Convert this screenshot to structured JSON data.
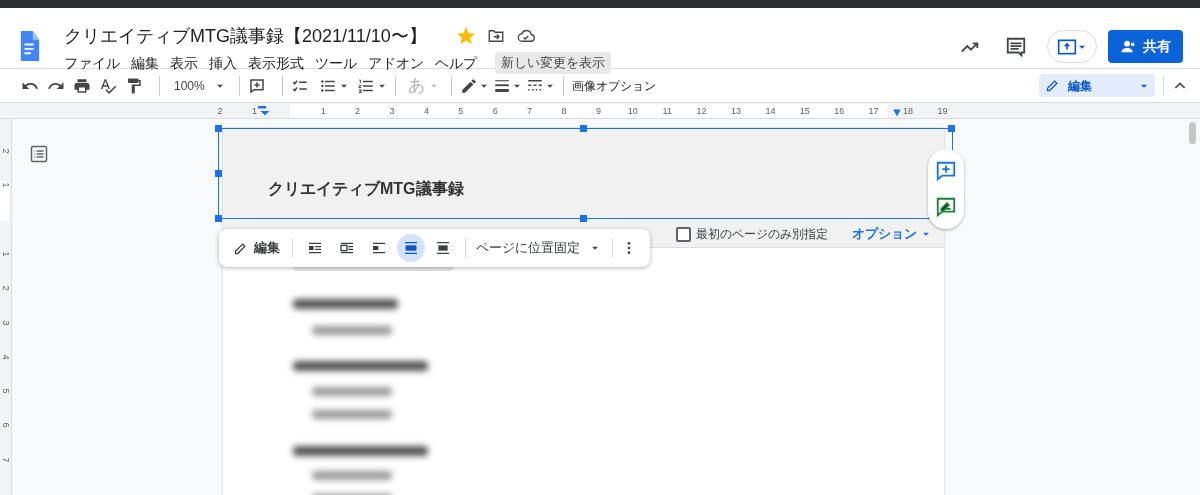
{
  "app": {
    "title": "クリエイティブMTG議事録【2021/11/10〜】",
    "starred": true,
    "menu": [
      "ファイル",
      "編集",
      "表示",
      "挿入",
      "表示形式",
      "ツール",
      "アドオン",
      "ヘルプ"
    ],
    "new_changes": "新しい変更を表示",
    "share": "共有"
  },
  "toolbar": {
    "zoom": "100%",
    "font_char": {
      "label": "あ",
      "disabled": true
    },
    "image_options": "画像オプション",
    "mode": "編集"
  },
  "ruler": {
    "horizontal": [
      "2",
      "1",
      "1",
      "2",
      "3",
      "4",
      "5",
      "6",
      "7",
      "8",
      "9",
      "10",
      "11",
      "12",
      "13",
      "14",
      "15",
      "16",
      "17",
      "18",
      "19"
    ],
    "vertical": [
      "2",
      "1",
      "1",
      "2",
      "3",
      "4",
      "5",
      "6",
      "7"
    ]
  },
  "document": {
    "header_text": "クリエイティブMTG議事録",
    "first_page_different": {
      "label": "最初のページのみ別指定",
      "checked": false
    },
    "options": "オプション",
    "blurred_blocks": [
      {
        "kind": "heading"
      },
      {
        "kind": "bullet"
      },
      {
        "kind": "heading"
      },
      {
        "kind": "bullet"
      },
      {
        "kind": "bullet"
      },
      {
        "kind": "heading"
      },
      {
        "kind": "bullet"
      },
      {
        "kind": "bullet"
      }
    ]
  },
  "image_toolbar": {
    "edit": "編集",
    "wrap_options": [
      {
        "selected": false
      },
      {
        "selected": false
      },
      {
        "selected": false
      },
      {
        "selected": true
      },
      {
        "selected": false
      }
    ],
    "position": "ページに位置固定"
  }
}
